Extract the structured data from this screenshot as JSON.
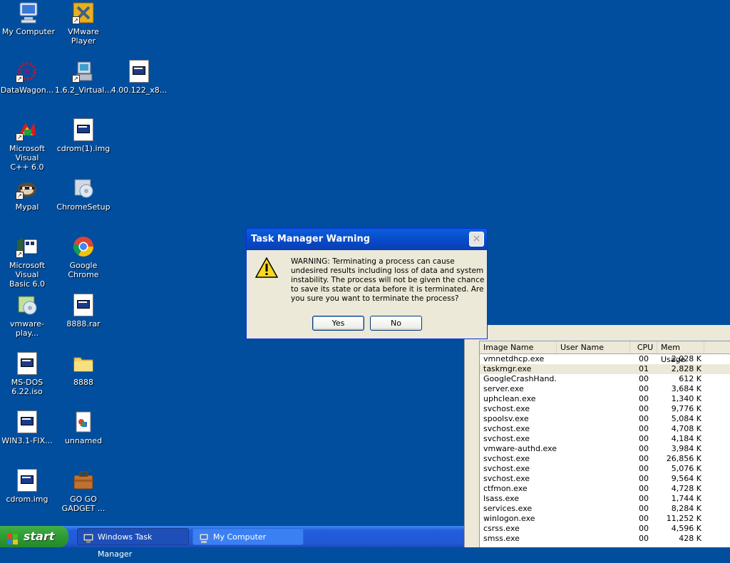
{
  "desktop": {
    "icons": [
      {
        "label": "My Computer",
        "icon": "my-computer-icon"
      },
      {
        "label": "VMware Player",
        "icon": "vmware-player-icon"
      },
      {
        "label": "DataWagon...",
        "icon": "datawagon-icon"
      },
      {
        "label": "1.6.2_Virtual...",
        "icon": "installer-icon"
      },
      {
        "label": "4.00.122_x8...",
        "icon": "file-icon"
      },
      {
        "label": "Microsoft Visual\nC++ 6.0",
        "icon": "visual-cpp-icon"
      },
      {
        "label": "cdrom(1).img",
        "icon": "file-icon"
      },
      {
        "label": "Mypal",
        "icon": "mypal-icon"
      },
      {
        "label": "ChromeSetup",
        "icon": "installer-icon"
      },
      {
        "label": "Microsoft Visual\nBasic 6.0",
        "icon": "visual-basic-icon"
      },
      {
        "label": "Google Chrome",
        "icon": "chrome-icon"
      },
      {
        "label": "vmware-play...",
        "icon": "installer-icon"
      },
      {
        "label": "8888.rar",
        "icon": "file-icon"
      },
      {
        "label": "MS-DOS\n6.22.iso",
        "icon": "file-icon"
      },
      {
        "label": "8888",
        "icon": "folder-icon"
      },
      {
        "label": "WIN3.1-FIX...",
        "icon": "file-icon"
      },
      {
        "label": "unnamed",
        "icon": "image-file-icon"
      },
      {
        "label": "cdrom.img",
        "icon": "file-icon"
      },
      {
        "label": "GO GO\nGADGET ...",
        "icon": "briefcase-icon"
      }
    ]
  },
  "dialog": {
    "title": "Task Manager Warning",
    "close_label": "×",
    "message": "WARNING: Terminating a process can cause undesired results including loss of data and system instability. The process will not be given the chance to save its state or data before it is terminated.  Are you sure you want to terminate the process?",
    "yes_label": "Yes",
    "no_label": "No"
  },
  "task_manager": {
    "columns": [
      "Image Name",
      "User Name",
      "CPU",
      "Mem Usage"
    ],
    "rows": [
      {
        "name": "vmnetdhcp.exe",
        "user": "",
        "cpu": "00",
        "mem": "2,028 K"
      },
      {
        "name": "taskmgr.exe",
        "user": "",
        "cpu": "01",
        "mem": "2,828 K",
        "selected": true
      },
      {
        "name": "GoogleCrashHand...",
        "user": "",
        "cpu": "00",
        "mem": "612 K"
      },
      {
        "name": "server.exe",
        "user": "",
        "cpu": "00",
        "mem": "3,684 K"
      },
      {
        "name": "uphclean.exe",
        "user": "",
        "cpu": "00",
        "mem": "1,340 K"
      },
      {
        "name": "svchost.exe",
        "user": "",
        "cpu": "00",
        "mem": "9,776 K"
      },
      {
        "name": "spoolsv.exe",
        "user": "",
        "cpu": "00",
        "mem": "5,084 K"
      },
      {
        "name": "svchost.exe",
        "user": "",
        "cpu": "00",
        "mem": "4,708 K"
      },
      {
        "name": "svchost.exe",
        "user": "",
        "cpu": "00",
        "mem": "4,184 K"
      },
      {
        "name": "vmware-authd.exe",
        "user": "",
        "cpu": "00",
        "mem": "3,984 K"
      },
      {
        "name": "svchost.exe",
        "user": "",
        "cpu": "00",
        "mem": "26,856 K"
      },
      {
        "name": "svchost.exe",
        "user": "",
        "cpu": "00",
        "mem": "5,076 K"
      },
      {
        "name": "svchost.exe",
        "user": "",
        "cpu": "00",
        "mem": "9,564 K"
      },
      {
        "name": "ctfmon.exe",
        "user": "",
        "cpu": "00",
        "mem": "4,728 K"
      },
      {
        "name": "lsass.exe",
        "user": "",
        "cpu": "00",
        "mem": "1,744 K"
      },
      {
        "name": "services.exe",
        "user": "",
        "cpu": "00",
        "mem": "8,284 K"
      },
      {
        "name": "winlogon.exe",
        "user": "",
        "cpu": "00",
        "mem": "11,252 K"
      },
      {
        "name": "csrss.exe",
        "user": "",
        "cpu": "00",
        "mem": "4,596 K"
      },
      {
        "name": "smss.exe",
        "user": "",
        "cpu": "00",
        "mem": "428 K"
      }
    ]
  },
  "taskbar": {
    "start_label": "start",
    "tasks": [
      {
        "label": "Windows Task Manager",
        "icon": "task-manager-icon"
      },
      {
        "label": "My Computer",
        "icon": "my-computer-icon"
      }
    ]
  },
  "colors": {
    "desktop_bg": "#014e9e",
    "title_bar": "#0a5fd8",
    "start_button": "#2f9f36"
  }
}
